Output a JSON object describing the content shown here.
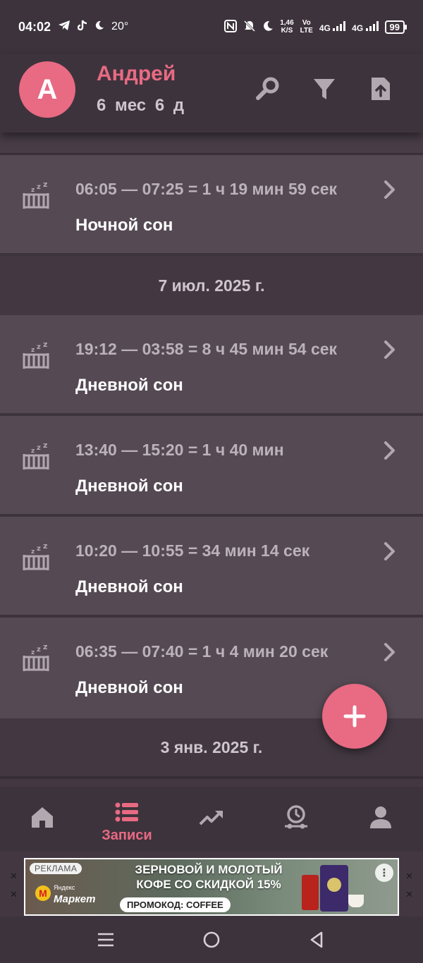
{
  "status_bar": {
    "time": "04:02",
    "temperature": "20°",
    "network_speed": "1,46",
    "network_speed_unit": "K/S",
    "volte_line1": "Vo",
    "volte_line2": "LTE",
    "sim1": "4G",
    "sim2": "4G",
    "battery": "99"
  },
  "header": {
    "avatar_letter": "A",
    "child_name": "Андрей",
    "child_age": "6 мес  6 д"
  },
  "entries_group_top": [
    {
      "time": "06:05 — 07:25 = 1 ч 19 мин 59 сек",
      "type": "Ночной сон"
    }
  ],
  "date_header_1": "7 июл. 2025 г.",
  "entries_group_2": [
    {
      "time": "19:12 — 03:58 = 8 ч 45 мин 54 сек",
      "type": "Дневной сон"
    },
    {
      "time": "13:40 — 15:20 = 1 ч 40 мин",
      "type": "Дневной сон"
    },
    {
      "time": "10:20 — 10:55 = 34 мин 14 сек",
      "type": "Дневной сон"
    },
    {
      "time": "06:35 — 07:40 = 1 ч 4 мин 20 сек",
      "type": "Дневной сон"
    }
  ],
  "date_header_2": "3 янв. 2025 г.",
  "bottom_nav": {
    "items": [
      {
        "icon": "home-icon",
        "label": ""
      },
      {
        "icon": "list-icon",
        "label": "Записи",
        "active": true
      },
      {
        "icon": "trending-icon",
        "label": ""
      },
      {
        "icon": "timeline-clock-icon",
        "label": ""
      },
      {
        "icon": "person-icon",
        "label": ""
      }
    ]
  },
  "ad": {
    "badge": "РЕКЛАМА",
    "brand_small": "Яндекс",
    "brand_name": "Маркет",
    "headline": "ЗЕРНОВОЙ И МОЛОТЫЙ КОФЕ СО СКИДКОЙ 15%",
    "promo": "ПРОМОКОД: COFFEE",
    "more": "⋮"
  },
  "colors": {
    "accent": "#e86a83",
    "background": "#433842",
    "card": "#554a54",
    "header": "#3d333c",
    "muted_text": "#bcb2ba",
    "icon": "#b2a8b0"
  }
}
